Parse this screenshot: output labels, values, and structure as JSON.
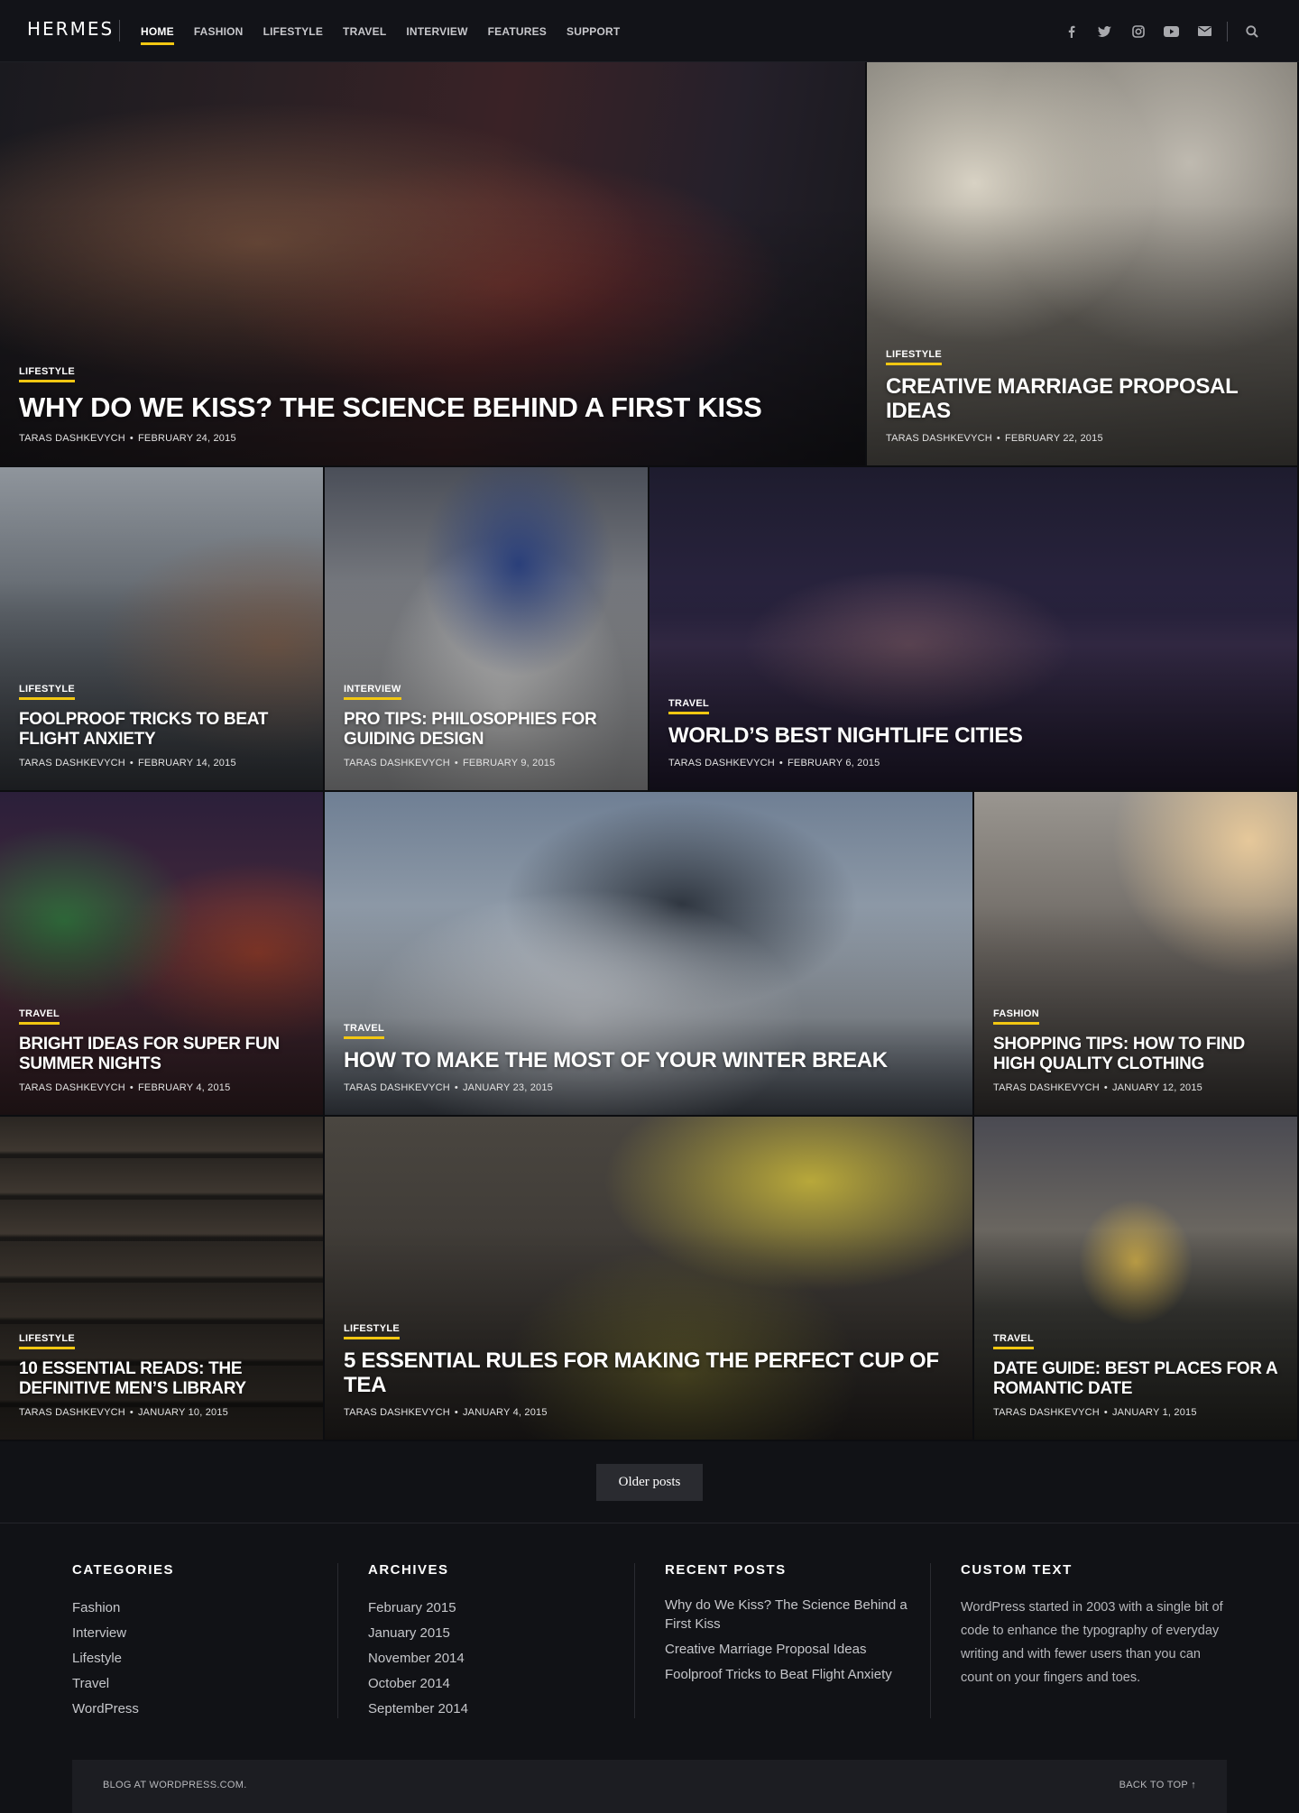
{
  "header": {
    "logo": "HERMES",
    "nav": [
      {
        "label": "HOME",
        "active": true
      },
      {
        "label": "FASHION",
        "active": false
      },
      {
        "label": "LIFESTYLE",
        "active": false
      },
      {
        "label": "TRAVEL",
        "active": false
      },
      {
        "label": "INTERVIEW",
        "active": false
      },
      {
        "label": "FEATURES",
        "active": false
      },
      {
        "label": "SUPPORT",
        "active": false
      }
    ],
    "social_icons": [
      "facebook-icon",
      "twitter-icon",
      "instagram-icon",
      "youtube-icon",
      "email-icon"
    ],
    "search_icon": "search-icon"
  },
  "posts": [
    {
      "category": "LIFESTYLE",
      "title": "WHY DO WE KISS? THE SCIENCE BEHIND A FIRST KISS",
      "author": "TARAS DASHKEVYCH",
      "date": "FEBRUARY 24, 2015"
    },
    {
      "category": "LIFESTYLE",
      "title": "CREATIVE MARRIAGE PROPOSAL IDEAS",
      "author": "TARAS DASHKEVYCH",
      "date": "FEBRUARY 22, 2015"
    },
    {
      "category": "LIFESTYLE",
      "title": "FOOLPROOF TRICKS TO BEAT FLIGHT ANXIETY",
      "author": "TARAS DASHKEVYCH",
      "date": "FEBRUARY 14, 2015"
    },
    {
      "category": "INTERVIEW",
      "title": "PRO TIPS: PHILOSOPHIES FOR GUIDING DESIGN",
      "author": "TARAS DASHKEVYCH",
      "date": "FEBRUARY 9, 2015"
    },
    {
      "category": "TRAVEL",
      "title": "WORLD’S BEST NIGHTLIFE CITIES",
      "author": "TARAS DASHKEVYCH",
      "date": "FEBRUARY 6, 2015"
    },
    {
      "category": "TRAVEL",
      "title": "BRIGHT IDEAS FOR SUPER FUN SUMMER NIGHTS",
      "author": "TARAS DASHKEVYCH",
      "date": "FEBRUARY 4, 2015"
    },
    {
      "category": "TRAVEL",
      "title": "HOW TO MAKE THE MOST OF YOUR WINTER BREAK",
      "author": "TARAS DASHKEVYCH",
      "date": "JANUARY 23, 2015"
    },
    {
      "category": "FASHION",
      "title": "SHOPPING TIPS: HOW TO FIND HIGH QUALITY CLOTHING",
      "author": "TARAS DASHKEVYCH",
      "date": "JANUARY 12, 2015"
    },
    {
      "category": "LIFESTYLE",
      "title": "10 ESSENTIAL READS: THE DEFINITIVE MEN’S LIBRARY",
      "author": "TARAS DASHKEVYCH",
      "date": "JANUARY 10, 2015"
    },
    {
      "category": "LIFESTYLE",
      "title": "5 ESSENTIAL RULES FOR MAKING THE PERFECT CUP OF TEA",
      "author": "TARAS DASHKEVYCH",
      "date": "JANUARY 4, 2015"
    },
    {
      "category": "TRAVEL",
      "title": "DATE GUIDE: BEST PLACES FOR A ROMANTIC DATE",
      "author": "TARAS DASHKEVYCH",
      "date": "JANUARY 1, 2015"
    }
  ],
  "pagination": {
    "older_label": "Older posts"
  },
  "footer": {
    "categories": {
      "heading": "CATEGORIES",
      "items": [
        "Fashion",
        "Interview",
        "Lifestyle",
        "Travel",
        "WordPress"
      ]
    },
    "archives": {
      "heading": "ARCHIVES",
      "items": [
        "February 2015",
        "January 2015",
        "November 2014",
        "October 2014",
        "September 2014"
      ]
    },
    "recent": {
      "heading": "RECENT POSTS",
      "items": [
        "Why do We Kiss? The Science Behind a First Kiss",
        "Creative Marriage Proposal Ideas",
        "Foolproof Tricks to Beat Flight Anxiety"
      ]
    },
    "custom": {
      "heading": "CUSTOM TEXT",
      "text": "WordPress started in 2003 with a single bit of code to enhance the typography of everyday writing and with fewer users than you can count on your fingers and toes."
    },
    "credit": "BLOG AT WORDPRESS.COM.",
    "back_to_top": "BACK TO TOP ↑"
  },
  "colors": {
    "accent": "#f2c712",
    "background": "#111216"
  }
}
